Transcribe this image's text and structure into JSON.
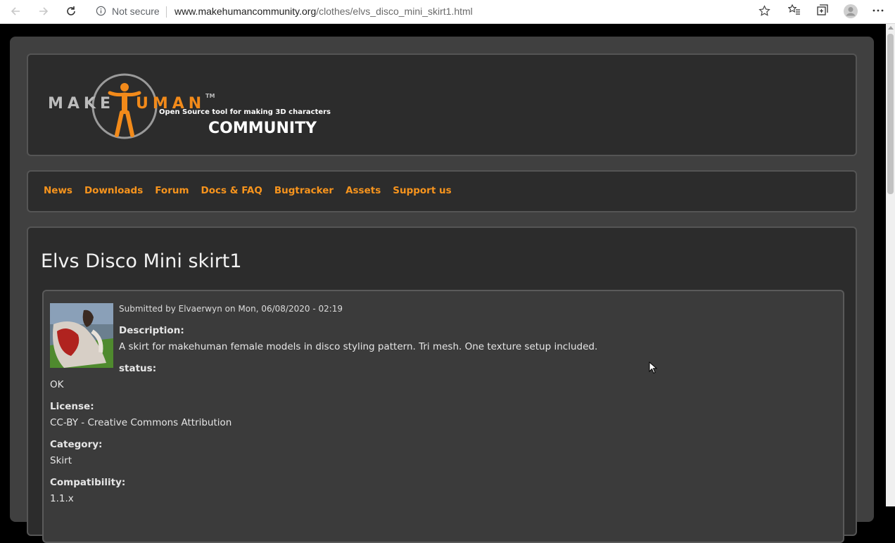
{
  "browser": {
    "security_label": "Not secure",
    "url_domain": "www.makehumancommunity.org",
    "url_path": "/clothes/elvs_disco_mini_skirt1.html"
  },
  "logo": {
    "make": "MAKE",
    "uman": "UMAN",
    "trademark": "TM",
    "tagline": "Open Source tool for making 3D characters",
    "community": "COMMUNITY"
  },
  "nav": {
    "items": [
      {
        "label": "News"
      },
      {
        "label": "Downloads"
      },
      {
        "label": "Forum"
      },
      {
        "label": "Docs & FAQ"
      },
      {
        "label": "Bugtracker"
      },
      {
        "label": "Assets"
      },
      {
        "label": "Support us"
      }
    ]
  },
  "node": {
    "title": "Elvs Disco Mini skirt1",
    "submitted": "Submitted by Elvaerwyn on Mon, 06/08/2020 - 02:19",
    "description_label": "Description:",
    "description": "A skirt for makehuman female models in disco styling pattern. Tri mesh. One texture setup included.",
    "status_label": "status:",
    "status": "OK",
    "license_label": "License:",
    "license": "CC-BY - Creative Commons Attribution",
    "category_label": "Category:",
    "category": "Skirt",
    "compatibility_label": "Compatibility:",
    "compatibility": "1.1.x"
  },
  "colors": {
    "accent": "#f7941d",
    "background": "#404040",
    "panel": "#2c2c2c"
  }
}
